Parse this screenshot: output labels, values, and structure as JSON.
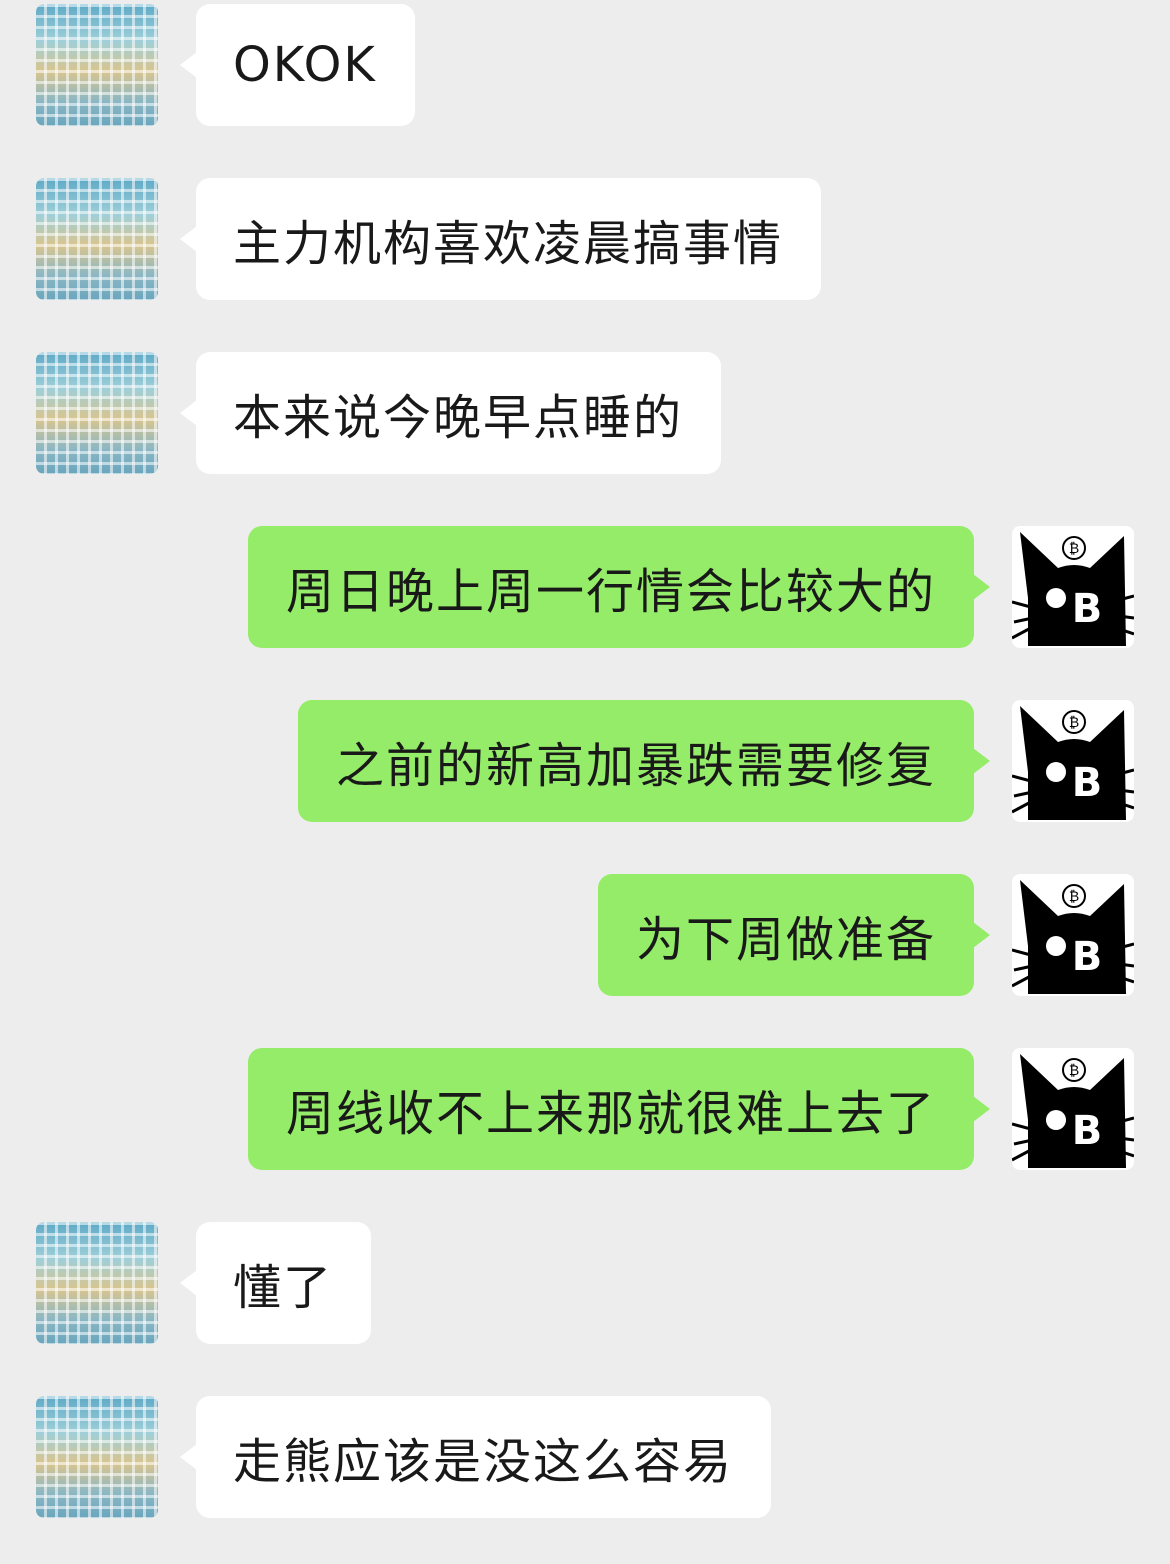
{
  "chat": {
    "messages": [
      {
        "sender": "other",
        "avatar": "contact-mosaic-avatar",
        "text": "OKOK"
      },
      {
        "sender": "other",
        "avatar": "contact-mosaic-avatar",
        "text": "主力机构喜欢凌晨搞事情"
      },
      {
        "sender": "other",
        "avatar": "contact-mosaic-avatar",
        "text": "本来说今晚早点睡的"
      },
      {
        "sender": "self",
        "avatar": "bitcoin-cat-avatar",
        "text": "周日晚上周一行情会比较大的"
      },
      {
        "sender": "self",
        "avatar": "bitcoin-cat-avatar",
        "text": "之前的新高加暴跌需要修复"
      },
      {
        "sender": "self",
        "avatar": "bitcoin-cat-avatar",
        "text": "为下周做准备"
      },
      {
        "sender": "self",
        "avatar": "bitcoin-cat-avatar",
        "text": "周线收不上来那就很难上去了"
      },
      {
        "sender": "other",
        "avatar": "contact-mosaic-avatar",
        "text": "懂了"
      },
      {
        "sender": "other",
        "avatar": "contact-mosaic-avatar",
        "text": "走熊应该是没这么容易"
      }
    ]
  },
  "colors": {
    "background": "#ededed",
    "incoming_bubble": "#ffffff",
    "outgoing_bubble": "#95ec69",
    "text": "#191919"
  }
}
